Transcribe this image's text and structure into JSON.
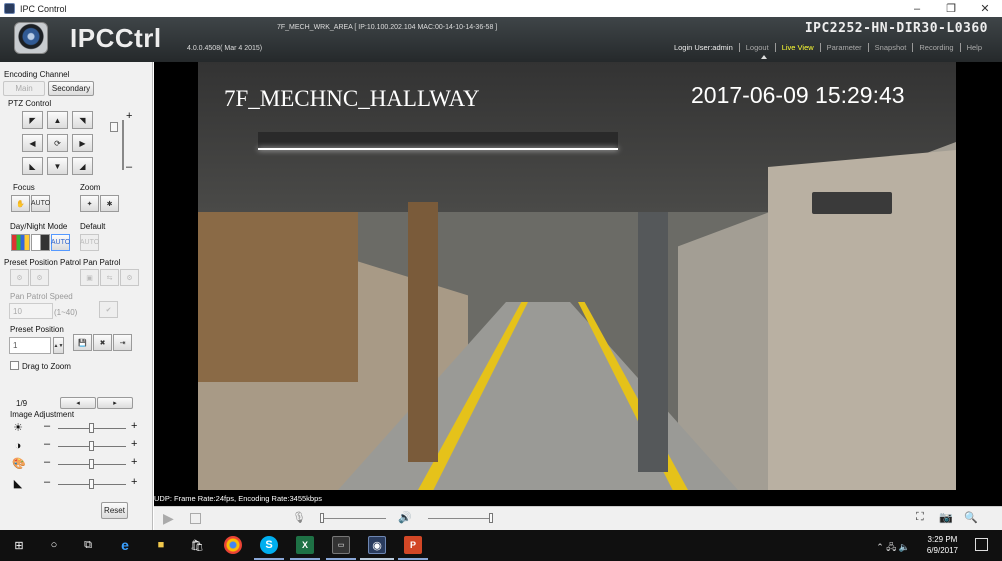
{
  "window": {
    "title": "IPC Control",
    "minimize": "–",
    "restore": "❐",
    "close": "✕"
  },
  "header": {
    "logo": "IPCCtrl",
    "version": "4.0.0.4508( Mar  4 2015)",
    "device_info": "7F_MECH_WRK_AREA [ IP:10.100.202.104  MAC:00-14-10-14-36-58 ]",
    "model": "IPC2252-HN-DIR30-L0360",
    "login_user": "Login User:admin",
    "nav": {
      "logout": "Logout",
      "live_view": "Live View",
      "parameter": "Parameter",
      "snapshot": "Snapshot",
      "recording": "Recording",
      "help": "Help"
    },
    "active_color": "#ffff33"
  },
  "panel": {
    "encoding_channel": "Encoding Channel",
    "main": "Main",
    "secondary": "Secondary",
    "ptz_control": "PTZ Control",
    "ptz_speed_plus": "+",
    "ptz_speed_minus": "–",
    "focus": "Focus",
    "zoom": "Zoom",
    "auto": "AUTO",
    "day_night_mode": "Day/Night Mode",
    "default": "Default",
    "preset_position_patrol": "Preset Position Patrol",
    "pan_patrol": "Pan Patrol",
    "pan_patrol_speed": "Pan Patrol Speed",
    "pan_speed_value": "10",
    "pan_speed_range": "(1~40)",
    "preset_position": "Preset Position",
    "preset_value": "1",
    "drag_to_zoom": "Drag to Zoom",
    "page": "1/9",
    "image_adjustment": "Image Adjustment",
    "minus": "–",
    "plus": "+",
    "reset": "Reset"
  },
  "video": {
    "osd_title": "7F_MECHNC_HALLWAY",
    "osd_time": "2017-06-09  15:29:43"
  },
  "status": {
    "text": "UDP: Frame Rate:24fps, Encoding Rate:3455kbps"
  },
  "taskbar": {
    "time": "3:29 PM",
    "date": "6/9/2017"
  }
}
